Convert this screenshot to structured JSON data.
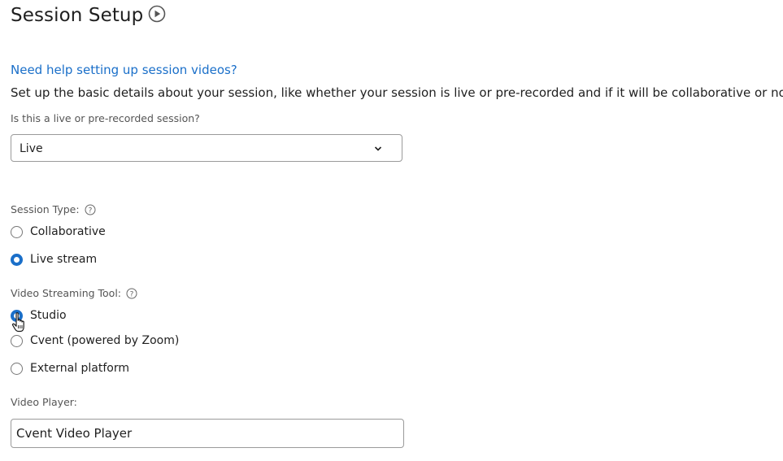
{
  "header": {
    "title": "Session Setup",
    "title_icon": "play-circle-icon"
  },
  "help_link": {
    "label": "Need help setting up session videos?"
  },
  "description": "Set up the basic details about your session, like whether your session is live or pre-recorded and if it will be collaborative or not.",
  "session_mode": {
    "label": "Is this a live or pre-recorded session?",
    "selected": "Live",
    "icon": "chevron-down-icon"
  },
  "session_type": {
    "label": "Session Type:",
    "help_icon": "help-circle-icon",
    "options": [
      {
        "label": "Collaborative",
        "checked": false
      },
      {
        "label": "Live stream",
        "checked": true
      }
    ]
  },
  "streaming_tool": {
    "label": "Video Streaming Tool:",
    "help_icon": "help-circle-icon",
    "options": [
      {
        "label": "Studio",
        "checked": true
      },
      {
        "label": "Cvent (powered by Zoom)",
        "checked": false
      },
      {
        "label": "External platform",
        "checked": false
      }
    ]
  },
  "video_player": {
    "label": "Video Player:",
    "value": "Cvent Video Player"
  },
  "colors": {
    "accent": "#1a6fc9",
    "text": "#1f1f1f",
    "label": "#555555",
    "border": "#9a9a9a"
  }
}
